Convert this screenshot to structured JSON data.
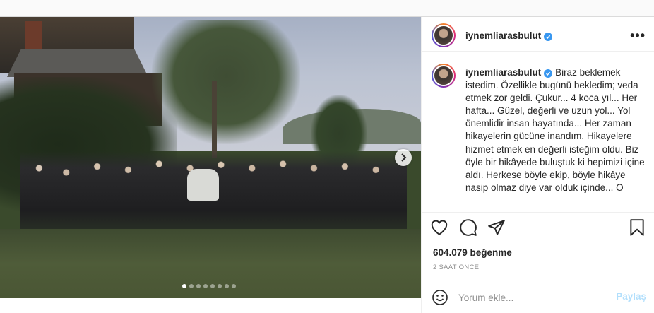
{
  "post": {
    "username": "iynemliarasbulut",
    "verified": true,
    "caption": "Biraz beklemek istedim. Özellikle bugünü bekledim; veda etmek zor geldi. Çukur... 4 koca yıl... Her hafta... Güzel, değerli ve uzun yol... Yol önemlidir insan hayatında... Her zaman hikayelerin gücüne inandım. Hikayelere hizmet etmek en değerli isteğim oldu. Biz öyle bir hikâyede buluştuk ki hepimizi içine aldı. Herkese böyle ekip, böyle hikâye nasip olmaz diye var olduk içinde... O",
    "likes": "604.079 beğenme",
    "timestamp": "2 SAAT ÖNCE",
    "carousel": {
      "count": 8,
      "active_index": 0
    }
  },
  "header": {
    "more_label": "•••"
  },
  "comment": {
    "placeholder": "Yorum ekle...",
    "post_label": "Paylaş"
  },
  "icons": {
    "like": "heart-icon",
    "comment": "comment-icon",
    "share": "send-icon",
    "save": "bookmark-icon",
    "emoji": "smiley-icon",
    "next": "chevron-right-icon",
    "verified": "verified-badge-icon"
  },
  "colors": {
    "verified_blue": "#3897f0",
    "post_button_disabled": "#b2dffc",
    "muted_text": "#8e8e8e"
  }
}
